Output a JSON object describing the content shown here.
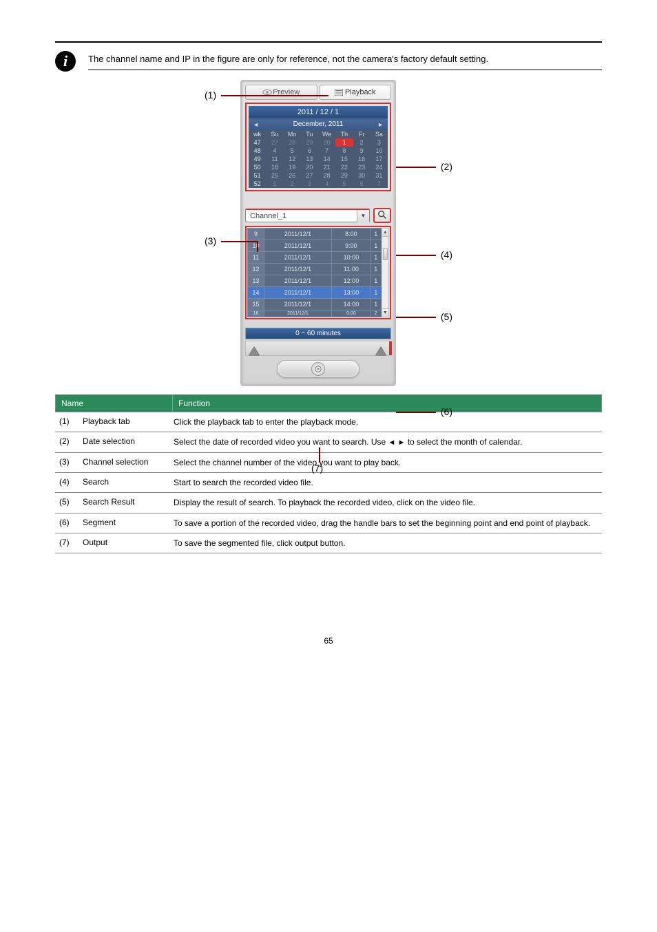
{
  "note": "The channel name and  IP in the figure are only for reference, not the camera's factory default  setting.",
  "figure": {
    "callouts": [
      "(1)",
      "(2)",
      "(3)",
      "(4)",
      "(5)",
      "(6)",
      "(7)"
    ],
    "tabs": {
      "preview": "Preview",
      "playback": "Playback"
    },
    "datebar": "2011 / 12 / 1",
    "monthyear": "December, 2011",
    "week_hdr": "wk",
    "days_hdr": [
      "Su",
      "Mo",
      "Tu",
      "We",
      "Th",
      "Fr",
      "Sa"
    ],
    "weeks": [
      {
        "wk": "47",
        "d": [
          "27",
          "28",
          "29",
          "30",
          "1",
          "2",
          "3"
        ],
        "dim": [
          0,
          1,
          2,
          3
        ],
        "sel": 4
      },
      {
        "wk": "48",
        "d": [
          "4",
          "5",
          "6",
          "7",
          "8",
          "9",
          "10"
        ]
      },
      {
        "wk": "49",
        "d": [
          "11",
          "12",
          "13",
          "14",
          "15",
          "16",
          "17"
        ]
      },
      {
        "wk": "50",
        "d": [
          "18",
          "19",
          "20",
          "21",
          "22",
          "23",
          "24"
        ]
      },
      {
        "wk": "51",
        "d": [
          "25",
          "26",
          "27",
          "28",
          "29",
          "30",
          "31"
        ]
      },
      {
        "wk": "52",
        "d": [
          "1",
          "2",
          "3",
          "4",
          "5",
          "6",
          "7"
        ],
        "dim": [
          0,
          1,
          2,
          3,
          4,
          5,
          6
        ]
      }
    ],
    "channel": "Channel_1",
    "results": [
      {
        "n": "9",
        "date": "2011/12/1",
        "time": "8:00",
        "c": "1"
      },
      {
        "n": "10",
        "date": "2011/12/1",
        "time": "9:00",
        "c": "1"
      },
      {
        "n": "11",
        "date": "2011/12/1",
        "time": "10:00",
        "c": "1"
      },
      {
        "n": "12",
        "date": "2011/12/1",
        "time": "11:00",
        "c": "1"
      },
      {
        "n": "13",
        "date": "2011/12/1",
        "time": "12:00",
        "c": "1"
      },
      {
        "n": "14",
        "date": "2011/12/1",
        "time": "13:00",
        "c": "1",
        "hl": true
      },
      {
        "n": "15",
        "date": "2011/12/1",
        "time": "14:00",
        "c": "1"
      },
      {
        "n": "16",
        "date": "2011/12/1",
        "time": "0:00",
        "c": "2",
        "cut": true
      }
    ],
    "minutes_label": "0  ~  60   minutes"
  },
  "table": {
    "header": {
      "name": "Name",
      "function": "Function"
    },
    "rows": [
      {
        "id": "(1)",
        "name": "Playback tab",
        "func": "Click the playback tab to enter the playback mode."
      },
      {
        "id": "(2)",
        "name": "Date selection",
        "func_a": "Select the date of recorded video you want to search. Use ",
        "func_b": " to select the month of calendar."
      },
      {
        "id": "(3)",
        "name": "Channel selection",
        "func": "Select the channel number of the video you want to play back."
      },
      {
        "id": "(4)",
        "name": "Search",
        "func": "Start to search the recorded video file."
      },
      {
        "id": "(5)",
        "name": "Search Result",
        "func": "Display the result of search. To playback the recorded video, click on the video file."
      },
      {
        "id": "(6)",
        "name": "Segment",
        "func": "To save a portion of the recorded video, drag the handle bars to set the beginning point and end point of playback."
      },
      {
        "id": "(7)",
        "name": "Output",
        "func": "To save the segmented file, click output button."
      }
    ]
  },
  "page_number": "65"
}
